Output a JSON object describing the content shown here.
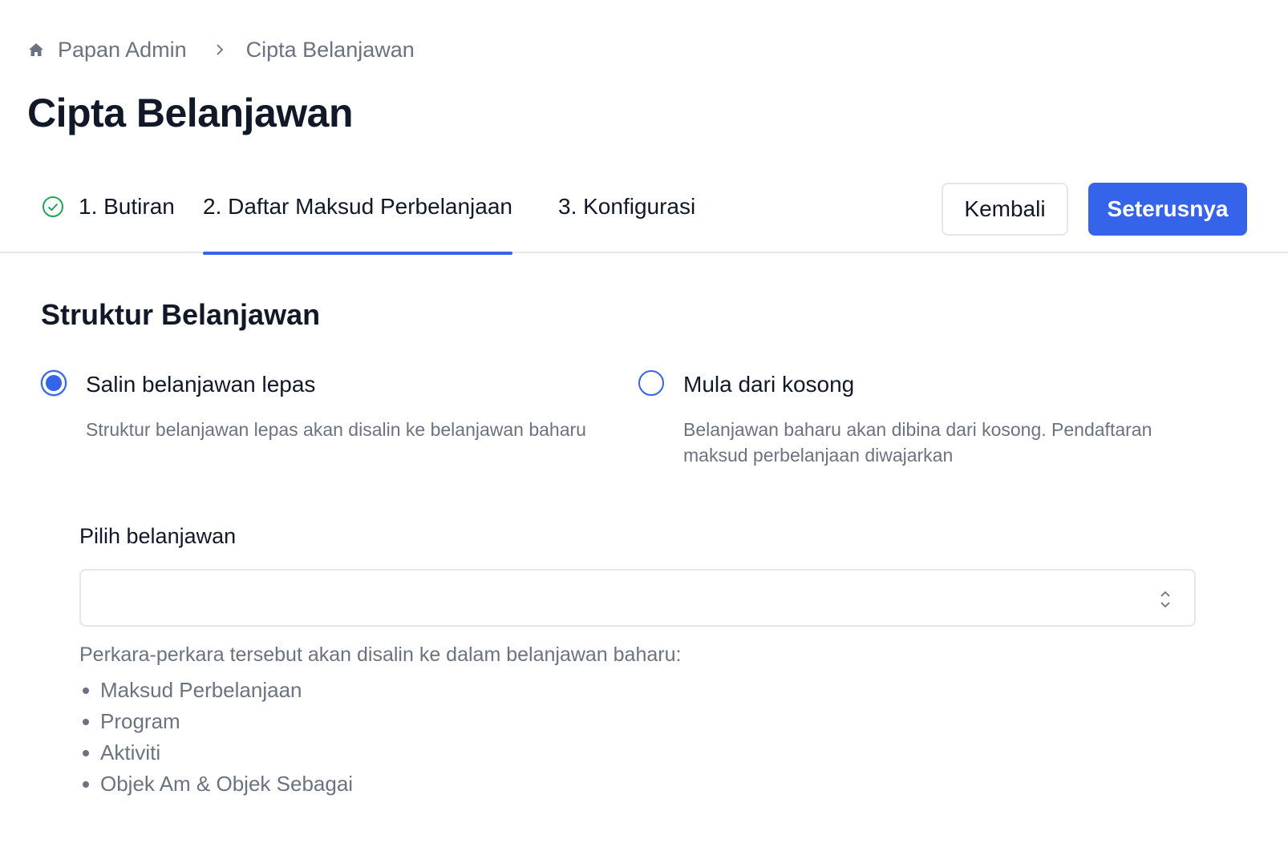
{
  "breadcrumb": {
    "home_icon": "home-icon",
    "items": [
      "Papan Admin",
      "Cipta Belanjawan"
    ],
    "separator_icon": "chevron-right-icon"
  },
  "page": {
    "title": "Cipta Belanjawan"
  },
  "steps": [
    {
      "label": "1. Butiran",
      "state": "completed",
      "icon": "check-circle-icon"
    },
    {
      "label": "2. Daftar Maksud Perbelanjaan",
      "state": "active"
    },
    {
      "label": "3. Konfigurasi",
      "state": "pending"
    }
  ],
  "actions": {
    "back_label": "Kembali",
    "next_label": "Seterusnya"
  },
  "colors": {
    "accent": "#3563e9",
    "success": "#22a55a",
    "muted_text": "#6b7280",
    "border": "#e5e7eb"
  },
  "structure": {
    "title": "Struktur Belanjawan",
    "options": [
      {
        "label": "Salin belanjawan lepas",
        "description": "Struktur belanjawan lepas akan disalin ke belanjawan baharu",
        "selected": true
      },
      {
        "label": "Mula dari kosong",
        "description": "Belanjawan baharu akan dibina dari kosong. Pendaftaran maksud perbelanjaan diwajarkan",
        "selected": false
      }
    ]
  },
  "budget_select": {
    "label": "Pilih belanjawan",
    "value": "",
    "icon": "chevron-up-down-icon"
  },
  "copy_info": {
    "note": "Perkara-perkara tersebut akan disalin ke dalam belanjawan baharu:",
    "items": [
      "Maksud Perbelanjaan",
      "Program",
      "Aktiviti",
      "Objek Am & Objek Sebagai"
    ]
  }
}
